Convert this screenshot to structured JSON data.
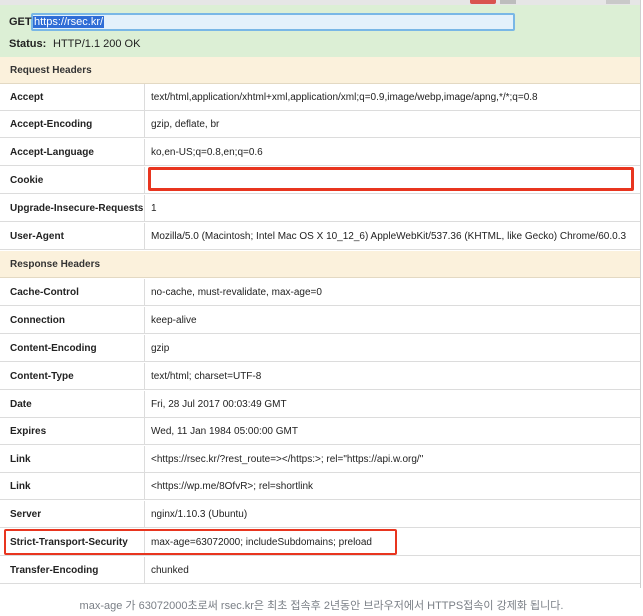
{
  "request_summary": {
    "method": "GET",
    "url": "https://rsec.kr/",
    "status_label": "Status:",
    "status_value": "HTTP/1.1 200 OK"
  },
  "request_headers": {
    "title": "Request Headers",
    "rows": [
      {
        "name": "Accept",
        "value": "text/html,application/xhtml+xml,application/xml;q=0.9,image/webp,image/apng,*/*;q=0.8"
      },
      {
        "name": "Accept-Encoding",
        "value": "gzip, deflate, br"
      },
      {
        "name": "Accept-Language",
        "value": "ko,en-US;q=0.8,en;q=0.6"
      },
      {
        "name": "Cookie",
        "value": ""
      },
      {
        "name": "Upgrade-Insecure-Requests",
        "value": "1"
      },
      {
        "name": "User-Agent",
        "value": "Mozilla/5.0 (Macintosh; Intel Mac OS X 10_12_6) AppleWebKit/537.36 (KHTML, like Gecko) Chrome/60.0.3"
      }
    ]
  },
  "response_headers": {
    "title": "Response Headers",
    "rows": [
      {
        "name": "Cache-Control",
        "value": "no-cache, must-revalidate, max-age=0"
      },
      {
        "name": "Connection",
        "value": "keep-alive"
      },
      {
        "name": "Content-Encoding",
        "value": "gzip"
      },
      {
        "name": "Content-Type",
        "value": "text/html; charset=UTF-8"
      },
      {
        "name": "Date",
        "value": "Fri, 28 Jul 2017 00:03:49 GMT"
      },
      {
        "name": "Expires",
        "value": "Wed, 11 Jan 1984 05:00:00 GMT"
      },
      {
        "name": "Link",
        "value": "<https://rsec.kr/?rest_route=></https:>; rel=\"https://api.w.org/\""
      },
      {
        "name": "Link",
        "value": "<https://wp.me/8OfvR>; rel=shortlink"
      },
      {
        "name": "Server",
        "value": "nginx/1.10.3 (Ubuntu)"
      },
      {
        "name": "Strict-Transport-Security",
        "value": "max-age=63072000; includeSubdomains; preload"
      },
      {
        "name": "Transfer-Encoding",
        "value": "chunked"
      }
    ]
  },
  "caption": "max-age 가 63072000초로써 rsec.kr은 최초 접속후 2년동안 브라우저에서 HTTPS접속이 강제화 됩니다.",
  "colors": {
    "summary_bg": "#dcefd5",
    "section_bg": "#fbf1dc",
    "highlight_red": "#e8351f",
    "url_focus": "#79b7e6"
  }
}
